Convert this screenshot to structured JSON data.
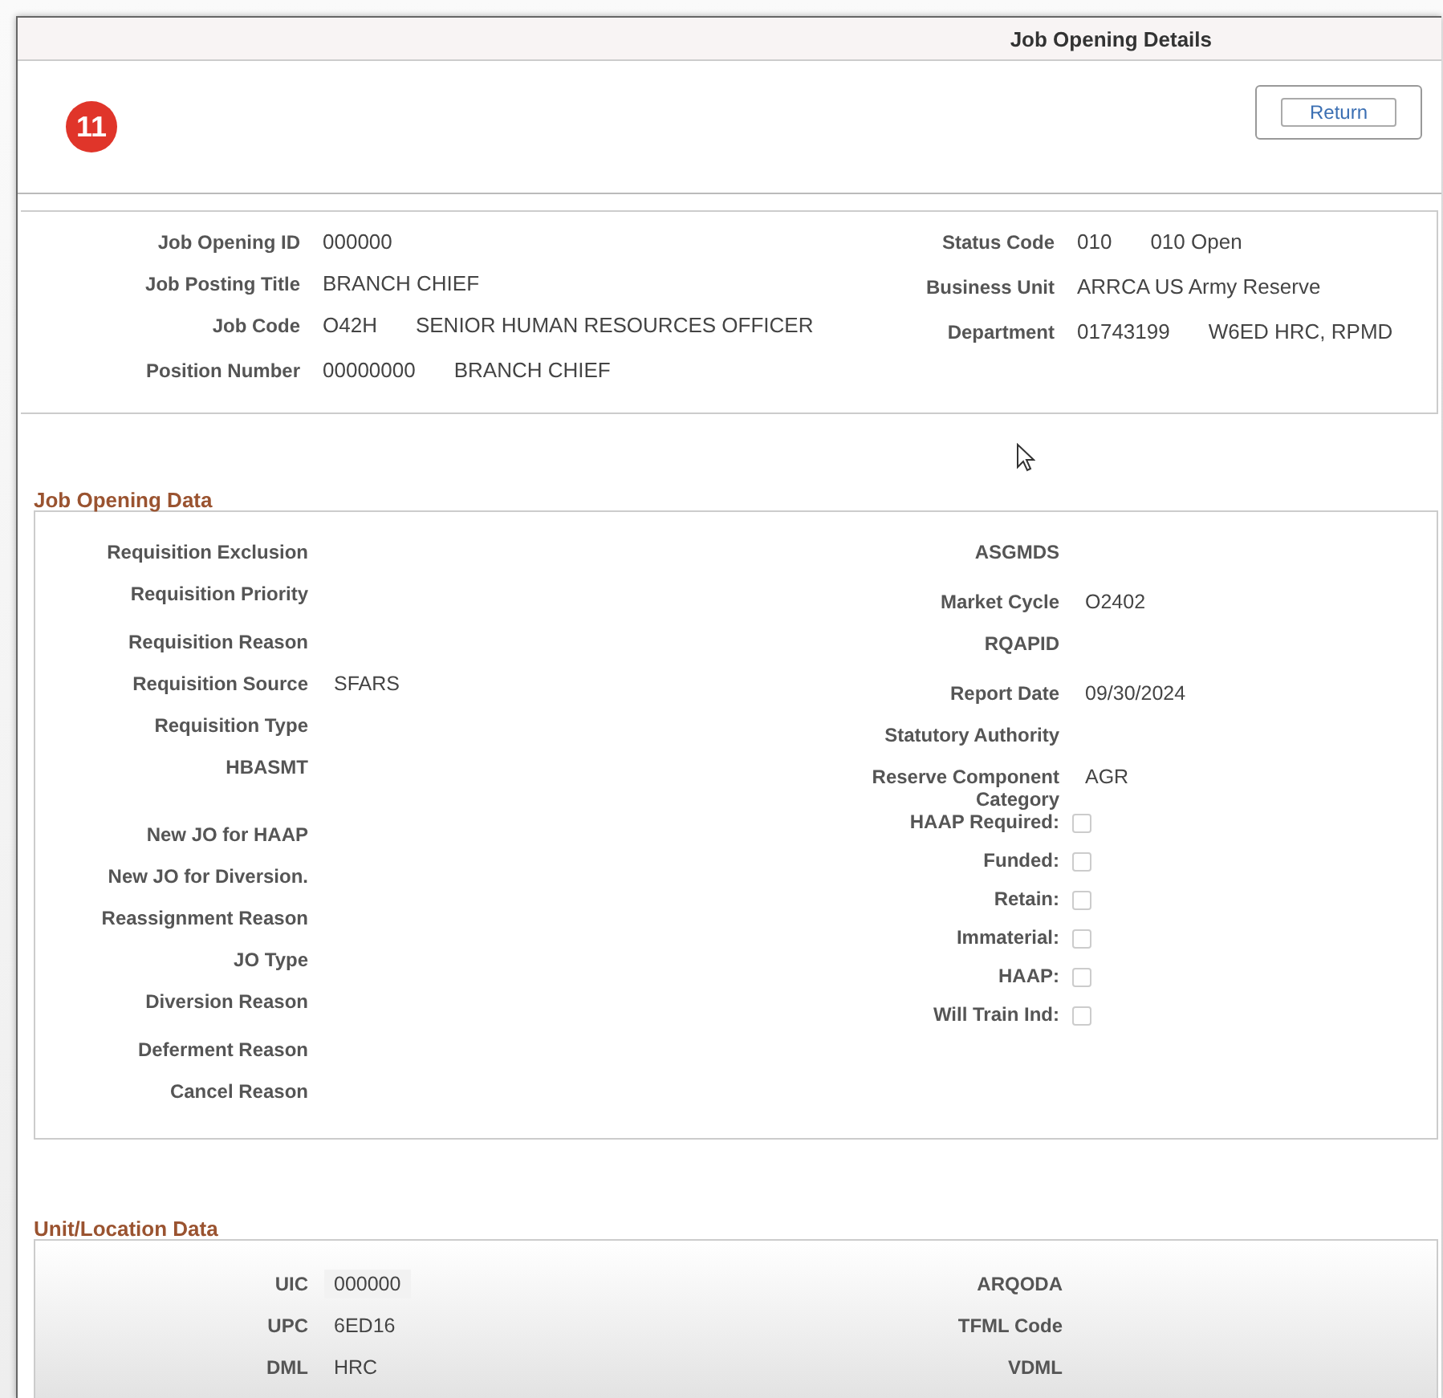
{
  "window": {
    "title": "Job Opening Details"
  },
  "badge": "11",
  "return_button": "Return",
  "header": {
    "left": [
      {
        "label": "Job Opening ID",
        "values": [
          "000000"
        ]
      },
      {
        "label": "Job Posting Title",
        "values": [
          "BRANCH CHIEF"
        ]
      },
      {
        "label": "Job Code",
        "values": [
          "O42H",
          "SENIOR HUMAN RESOURCES OFFICER"
        ]
      },
      {
        "label": "Position Number",
        "values": [
          "00000000",
          "BRANCH CHIEF"
        ]
      }
    ],
    "right": [
      {
        "label": "Status Code",
        "values": [
          "010",
          "010 Open"
        ]
      },
      {
        "label": "Business Unit",
        "values": [
          "ARRCA US Army Reserve"
        ]
      },
      {
        "label": "Department",
        "values": [
          "01743199",
          "W6ED HRC, RPMD"
        ]
      }
    ]
  },
  "sections": [
    {
      "title": "Job Opening Data",
      "left": [
        {
          "kind": "text",
          "label": "Requisition Exclusion"
        },
        {
          "kind": "text",
          "label": "Requisition Priority"
        },
        {
          "kind": "text",
          "label": "Requisition Reason"
        },
        {
          "kind": "text",
          "label": "Requisition Source",
          "value": "SFARS"
        },
        {
          "kind": "text",
          "label": "Requisition Type"
        },
        {
          "kind": "text",
          "label": "HBASMT"
        },
        {
          "kind": "text",
          "label": "New JO for HAAP"
        },
        {
          "kind": "text",
          "label": "New JO for Diversion."
        },
        {
          "kind": "text",
          "label": "Reassignment Reason"
        },
        {
          "kind": "text",
          "label": "JO Type"
        },
        {
          "kind": "text",
          "label": "Diversion Reason"
        },
        {
          "kind": "text",
          "label": "Deferment Reason"
        },
        {
          "kind": "text",
          "label": "Cancel Reason"
        }
      ],
      "right": [
        {
          "kind": "text",
          "label": "ASGMDS"
        },
        {
          "kind": "text",
          "label": "Market Cycle",
          "value": "O2402"
        },
        {
          "kind": "text",
          "label": "RQAPID"
        },
        {
          "kind": "text",
          "label": "Report Date",
          "value": "09/30/2024"
        },
        {
          "kind": "text",
          "label": "Statutory Authority"
        },
        {
          "kind": "text",
          "label": "Reserve Component Category",
          "value": "AGR"
        },
        {
          "kind": "checkbox",
          "label": "HAAP Required:",
          "checked": false
        },
        {
          "kind": "checkbox",
          "label": "Funded:",
          "checked": false
        },
        {
          "kind": "checkbox",
          "label": "Retain:",
          "checked": false
        },
        {
          "kind": "checkbox",
          "label": "Immaterial:",
          "checked": false
        },
        {
          "kind": "checkbox",
          "label": "HAAP:",
          "checked": false
        },
        {
          "kind": "checkbox",
          "label": "Will Train Ind:",
          "checked": false
        }
      ]
    },
    {
      "title": "Unit/Location Data",
      "left": [
        {
          "kind": "field",
          "label": "UIC",
          "value": "000000"
        },
        {
          "kind": "text",
          "label": "UPC",
          "value": "6ED16"
        },
        {
          "kind": "text",
          "label": "DML",
          "value": "HRC"
        }
      ],
      "right": [
        {
          "kind": "text",
          "label": "ARQODA"
        },
        {
          "kind": "text",
          "label": "TFML Code"
        },
        {
          "kind": "text",
          "label": "VDML"
        }
      ]
    }
  ]
}
